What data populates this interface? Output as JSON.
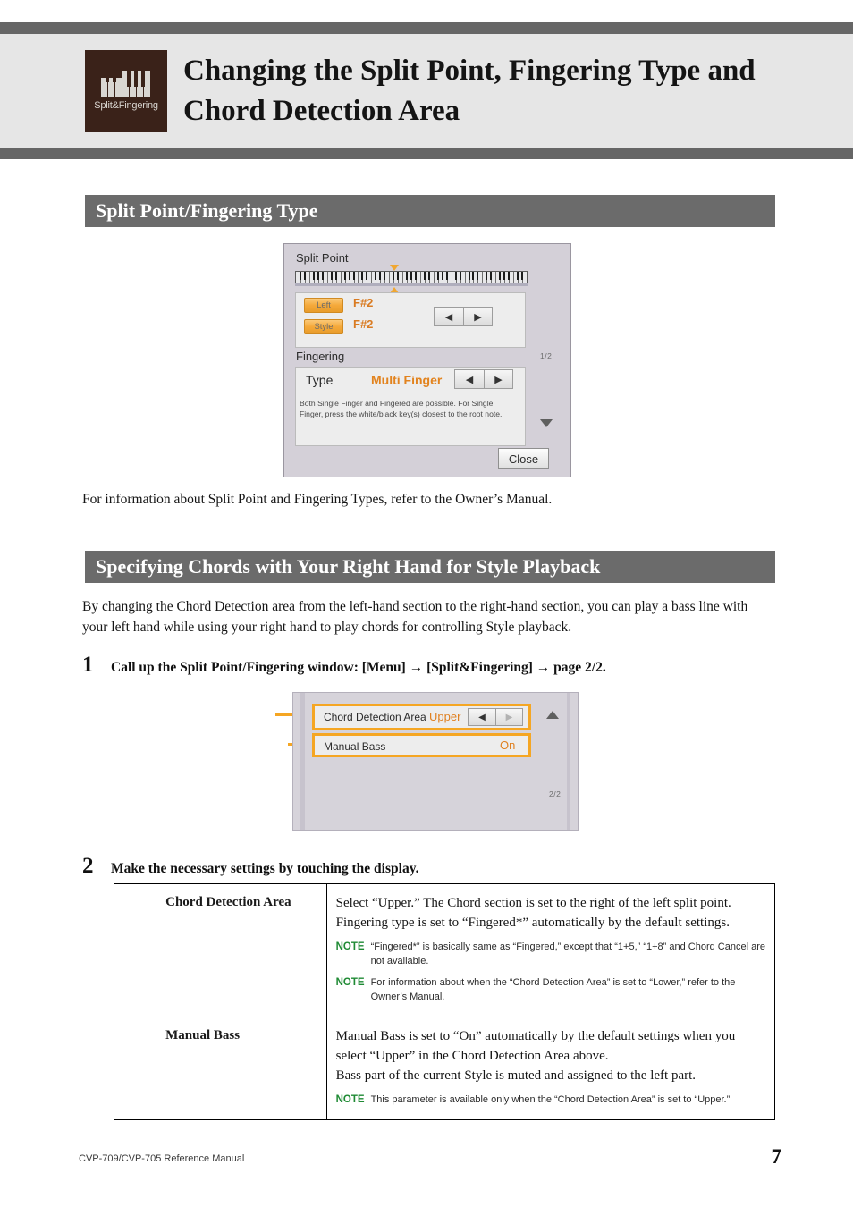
{
  "header": {
    "icon_name": "piano-keys-icon",
    "icon_label": "Split&Fingering",
    "title": "Changing the Split Point, Fingering Type and Chord Detection Area",
    "band_color": "#e6e6e6",
    "rule_color": "#666666",
    "icon_box_color": "#3a2219"
  },
  "sections": [
    {
      "id": "split",
      "title": "Split Point/Fingering Type",
      "bar_color": "#6b6b6b"
    },
    {
      "id": "chords",
      "title": "Specifying Chords with Your Right Hand for Style Playback",
      "bar_color": "#6b6b6b"
    }
  ],
  "paragraphs": {
    "after_split_shot": "For information about Split Point and Fingering Types, refer to the Owner’s Manual.",
    "chords_intro": "By changing the Chord Detection area from the left-hand section to the right-hand section, you can play a bass line with your left hand while using your right hand to play chords for controlling Style playback."
  },
  "steps": [
    {
      "number": "1",
      "text": "Call up the Split Point/Fingering window: [Menu] → [Split&Fingering] → page 2/2."
    },
    {
      "number": "2",
      "text": "Make the necessary settings by touching the display."
    }
  ],
  "screenshot_split_point": {
    "title": "Split Point",
    "keyboard": {
      "marker_color": "#f0a732",
      "marker_position_percent": 43
    },
    "rows": [
      {
        "button_label": "Left",
        "value": "F#2"
      },
      {
        "button_label": "Style",
        "value": "F#2"
      }
    ],
    "arrows": {
      "left": "◀",
      "right": "▶"
    },
    "fingering_title": "Fingering",
    "fingering_type_label": "Type",
    "fingering_type_value": "Multi Finger",
    "fingering_description": "Both Single Finger and Fingered are possible. For Single Finger, press the white/black key(s) closest to the root note.",
    "page_indicator": "1/2",
    "scroll_down_icon": "chevron-down-icon",
    "close_label": "Close",
    "accent_color": "#f5a93a",
    "value_color": "#d97b22"
  },
  "screenshot_chord_detection": {
    "rows": [
      {
        "label": "Chord Detection Area",
        "value": "Upper",
        "has_arrows": true
      },
      {
        "label": "Manual Bass",
        "value": "On",
        "has_arrows": false
      }
    ],
    "arrows": {
      "left": "◀",
      "right": "▶"
    },
    "page_indicator": "2/2",
    "scroll_up_icon": "chevron-up-icon",
    "highlight_color": "#f5a623",
    "value_color": "#e08020"
  },
  "settings_table": {
    "rows": [
      {
        "label": "Chord Detection Area",
        "description_lines": [
          "Select “Upper.” The Chord section is set to the right of the left split point.",
          "Fingering type is set to “Fingered*” automatically by the default settings."
        ],
        "notes": [
          {
            "tag": "NOTE",
            "body": "“Fingered*” is basically same as “Fingered,” except that “1+5,” “1+8” and Chord Cancel are not available."
          },
          {
            "tag": "NOTE",
            "body": "For information about when the “Chord Detection Area” is set to “Lower,” refer to the Owner’s Manual."
          }
        ]
      },
      {
        "label": "Manual Bass",
        "description_lines": [
          "Manual Bass is set to “On” automatically by the default settings when you select “Upper” in the Chord Detection Area above.",
          "Bass part of the current Style is muted and assigned to the left part."
        ],
        "notes": [
          {
            "tag": "NOTE",
            "body": "This parameter is available only when the “Chord Detection Area” is set to “Upper.”"
          }
        ]
      }
    ],
    "note_tag_color": "#1f8a34"
  },
  "footer": {
    "left": "CVP-709/CVP-705 Reference Manual",
    "page_number": "7"
  }
}
